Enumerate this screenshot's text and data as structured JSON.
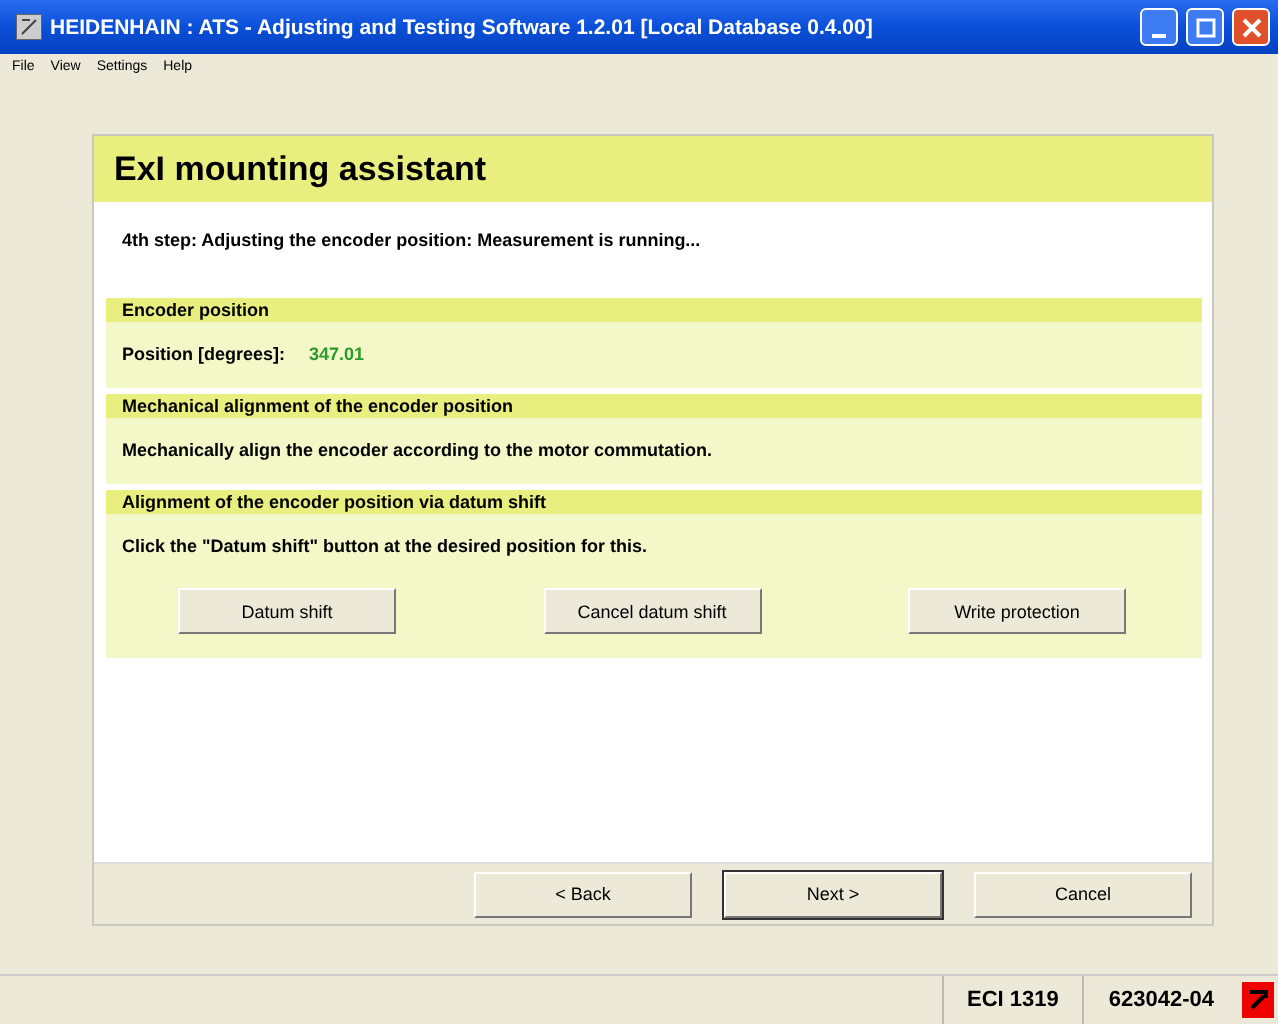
{
  "window": {
    "title": "HEIDENHAIN : ATS - Adjusting and Testing Software 1.2.01 [Local Database 0.4.00]"
  },
  "menu": [
    "File",
    "View",
    "Settings",
    "Help"
  ],
  "assistant": {
    "title": "ExI mounting assistant",
    "step": "4th step: Adjusting the encoder position: Measurement is running...",
    "sections": [
      {
        "kind": "reading",
        "heading": "Encoder position",
        "label": "Position [degrees]:",
        "value": "347.01"
      },
      {
        "kind": "text",
        "heading": "Mechanical alignment of the encoder position",
        "text": "Mechanically align the encoder according to the motor commutation."
      },
      {
        "kind": "actions",
        "heading": "Alignment of the encoder position via datum shift",
        "text": "Click the \"Datum shift\" button at the desired position for this.",
        "buttons": [
          "Datum shift",
          "Cancel datum shift",
          "Write protection"
        ]
      }
    ],
    "nav": [
      {
        "label": "< Back",
        "default": false
      },
      {
        "label": "Next >",
        "default": true
      },
      {
        "label": "Cancel",
        "default": false
      }
    ]
  },
  "status_bar": {
    "device": "ECI 1319",
    "id": "623042-04"
  }
}
